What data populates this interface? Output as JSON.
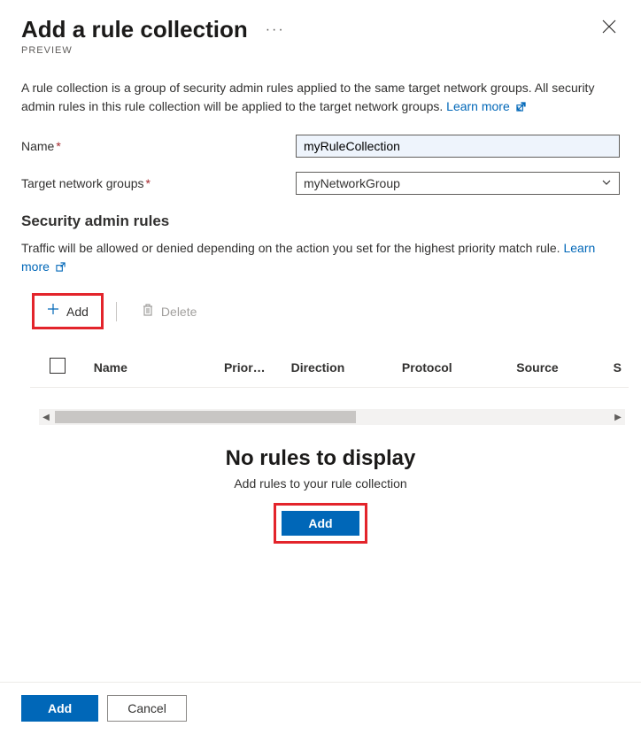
{
  "header": {
    "title": "Add a rule collection",
    "preview_tag": "PREVIEW"
  },
  "description": {
    "text": "A rule collection is a group of security admin rules applied to the same target network groups. All security admin rules in this rule collection will be applied to the target network groups. ",
    "learn_more": "Learn more"
  },
  "form": {
    "name_label": "Name",
    "name_value": "myRuleCollection",
    "target_groups_label": "Target network groups",
    "target_groups_value": "myNetworkGroup"
  },
  "security_rules": {
    "heading": "Security admin rules",
    "text": "Traffic will be allowed or denied depending on the action you set for the highest priority match rule. ",
    "learn_more": "Learn more"
  },
  "toolbar": {
    "add_label": "Add",
    "delete_label": "Delete"
  },
  "table": {
    "columns": {
      "name": "Name",
      "prior": "Prior…",
      "direction": "Direction",
      "protocol": "Protocol",
      "source": "Source",
      "s": "S"
    }
  },
  "empty_state": {
    "title": "No rules to display",
    "subtitle": "Add rules to your rule collection",
    "button": "Add"
  },
  "footer": {
    "add": "Add",
    "cancel": "Cancel"
  }
}
